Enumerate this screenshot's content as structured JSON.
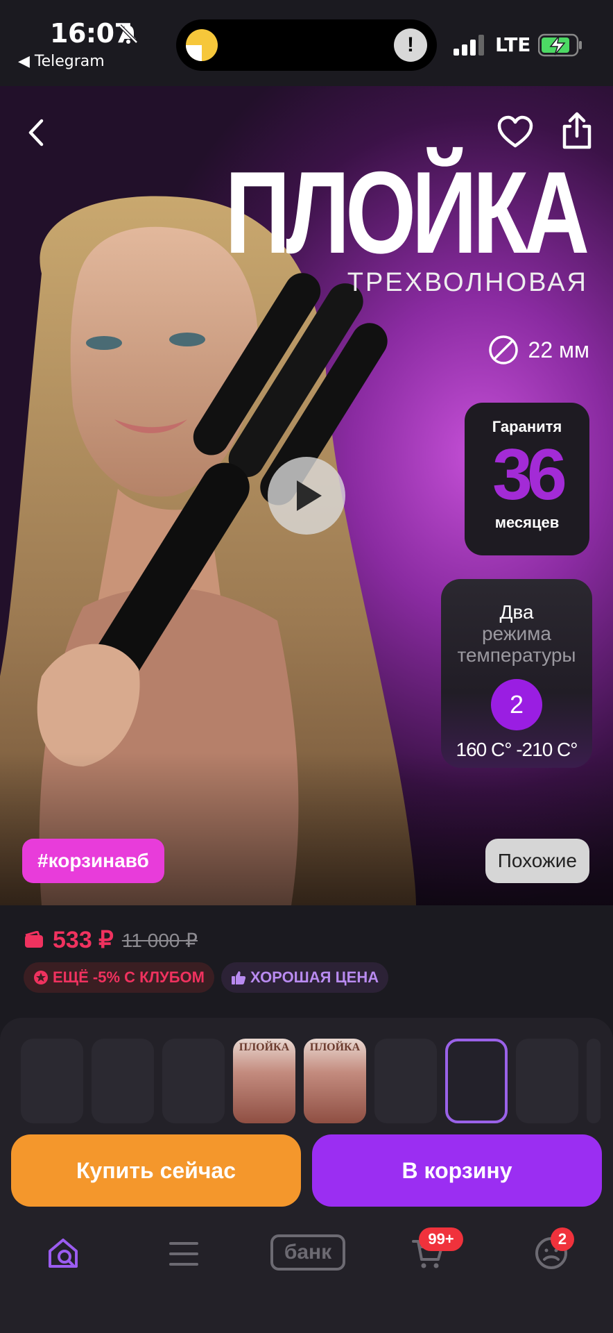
{
  "status_bar": {
    "time": "16:07",
    "back_app": "◀ Telegram",
    "network": "LTE"
  },
  "product": {
    "title": "ПЛОЙКА",
    "subtitle": "ТРЕХВОЛНОВАЯ",
    "diameter": "22 мм",
    "guarantee": {
      "top": "Гаранитя",
      "number": "36",
      "bottom": "месяцев"
    },
    "temperature": {
      "line1": "Два",
      "line2": "режима",
      "line3": "температуры",
      "modes": "2",
      "range": "160 C° -210 C°"
    },
    "tag": "#корзинавб",
    "similar_label": "Похожие"
  },
  "pricing": {
    "price": "533 ₽",
    "old_price": "11 000 ₽",
    "badge_club": "ЕЩЁ -5% С КЛУБОМ",
    "badge_good": "ХОРОШАЯ ЦЕНА"
  },
  "thumbnails": {
    "thumb_title": "ПЛОЙКА"
  },
  "actions": {
    "buy_now": "Купить сейчас",
    "add_to_cart": "В корзину"
  },
  "tabbar": {
    "bank_label": "банк",
    "cart_count": "99+",
    "profile_count": "2"
  },
  "colors": {
    "accent_purple": "#9b2ef2",
    "buy_orange": "#f4972c",
    "price_red": "#f0325f",
    "tag_pink": "#e83cda"
  }
}
